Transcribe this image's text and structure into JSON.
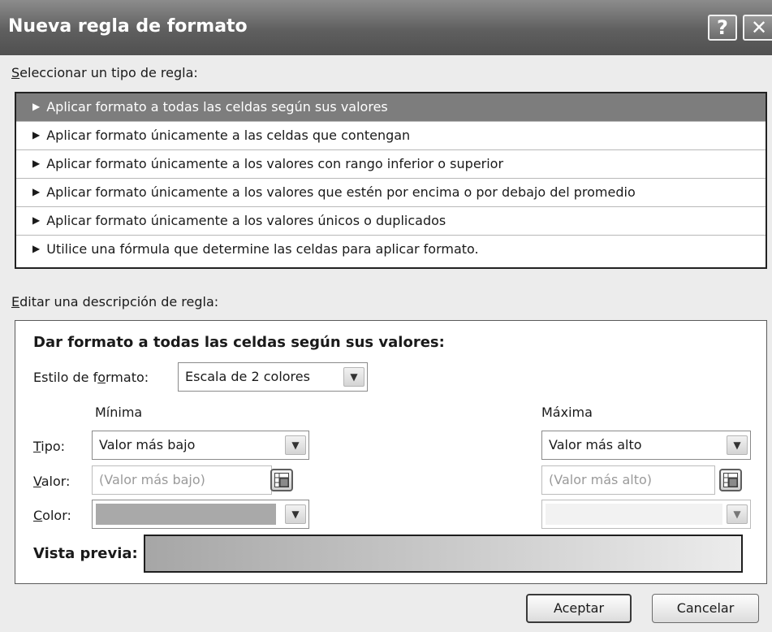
{
  "window": {
    "title": "Nueva regla de formato",
    "help_glyph": "?",
    "close_glyph": "✕"
  },
  "rule_type": {
    "label_accel": "S",
    "label_rest": "eleccionar un tipo de regla:",
    "items": [
      {
        "label": "Aplicar formato a todas las celdas según sus valores",
        "selected": true
      },
      {
        "label": "Aplicar formato únicamente a las celdas que contengan",
        "selected": false
      },
      {
        "label": "Aplicar formato únicamente a los valores con rango inferior o superior",
        "selected": false
      },
      {
        "label": "Aplicar formato únicamente a los valores que estén por encima o por debajo del promedio",
        "selected": false
      },
      {
        "label": "Aplicar formato únicamente a los valores únicos o duplicados",
        "selected": false
      },
      {
        "label": "Utilice una fórmula que determine las celdas para aplicar formato.",
        "selected": false
      }
    ]
  },
  "description": {
    "label_accel": "E",
    "label_rest": "ditar una descripción de regla:",
    "heading": "Dar formato a todas las celdas según sus valores:",
    "style_label_pre": "Estilo de f",
    "style_label_accel": "o",
    "style_label_post": "rmato:",
    "style_value": "Escala de 2 colores",
    "min_header": "Mínima",
    "max_header": "Máxima",
    "type_label_accel": "T",
    "type_label_rest": "ipo:",
    "value_label_accel": "V",
    "value_label_rest": "alor:",
    "color_label_accel": "C",
    "color_label_rest": "olor:",
    "min_type": "Valor más bajo",
    "max_type": "Valor más alto",
    "min_value_placeholder": "(Valor más bajo)",
    "max_value_placeholder": "(Valor más alto)",
    "min_color": "#a9a9a9",
    "max_color": "#f2f2f2",
    "preview_label": "Vista previa:",
    "preview_gradient": [
      "#a6a6a6",
      "#ececec"
    ]
  },
  "buttons": {
    "ok": "Aceptar",
    "cancel": "Cancelar"
  }
}
